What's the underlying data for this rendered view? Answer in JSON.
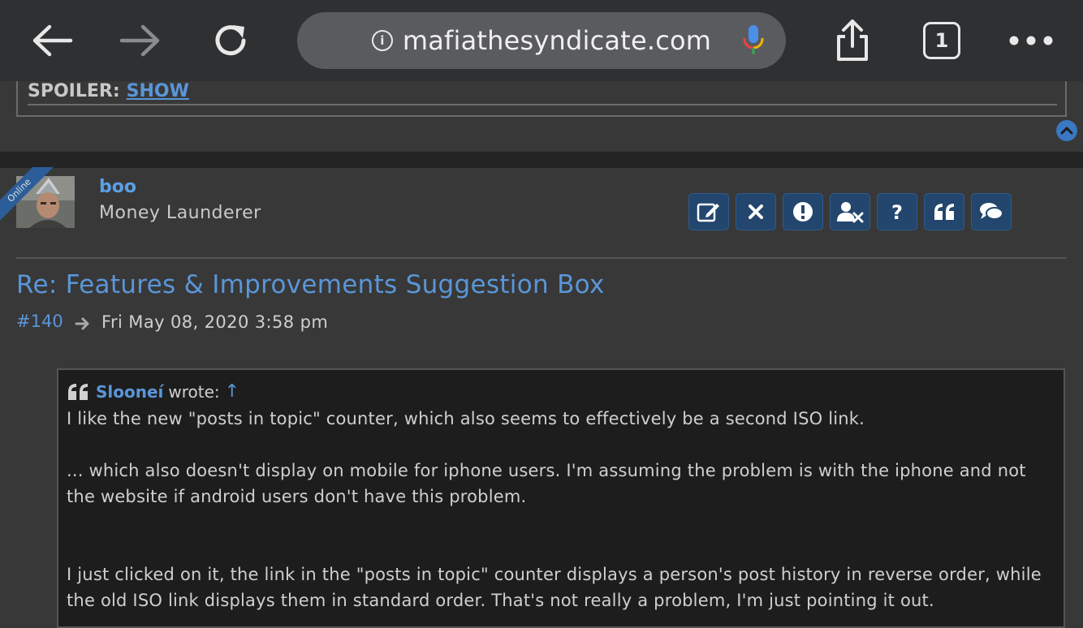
{
  "browser": {
    "url": "mafiathesyndicate.com",
    "tab_count": "1",
    "info_glyph": "i"
  },
  "spoiler": {
    "label": "SPOILER:",
    "link": "SHOW"
  },
  "post": {
    "online_badge": "Online",
    "username": "boo",
    "rank": "Money Launderer",
    "title": "Re: Features & Improvements Suggestion Box",
    "number": "#140",
    "date": "Fri May 08, 2020 3:58 pm"
  },
  "actions": [
    "edit-icon",
    "delete-icon",
    "report-icon",
    "warn-icon",
    "info-icon",
    "quote-icon",
    "reply-icon"
  ],
  "quote": {
    "author": "Slooneí",
    "wrote": "wrote:",
    "up": "↑",
    "paragraphs": [
      "I like the new \"posts in topic\" counter, which also seems to effectively be a second ISO link.",
      "... which also doesn't display on mobile for iphone users. I'm assuming the problem is with the iphone and not the website if android users don't have this problem.",
      "I just clicked on it, the link in the \"posts in topic\" counter displays a person's post history in reverse order, while the old ISO link displays them in standard order. That's not really a problem, I'm just pointing it out."
    ]
  },
  "colors": {
    "accent": "#5a96d8",
    "button_bg": "#23466e",
    "page_bg": "#383838",
    "toolbar_bg": "#2f3032"
  }
}
